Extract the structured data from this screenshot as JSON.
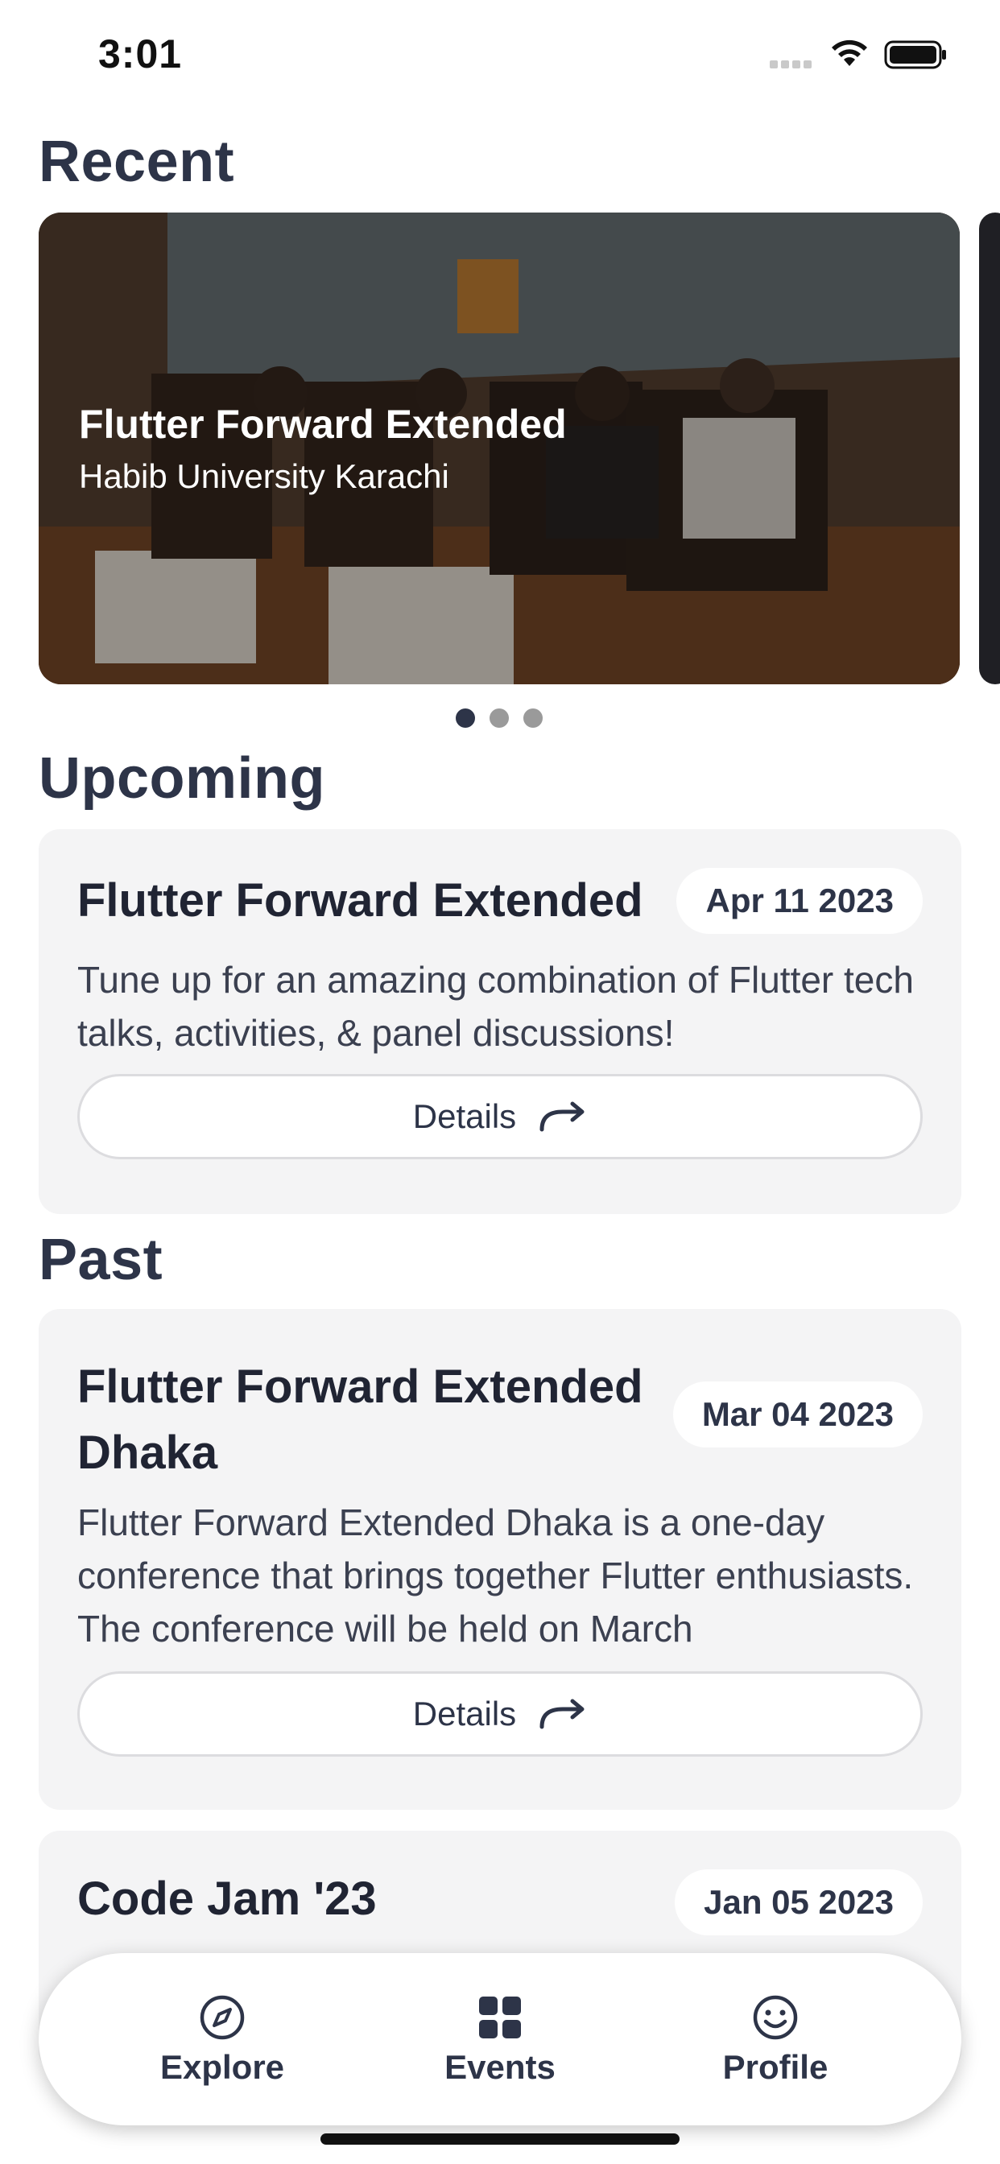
{
  "status_bar": {
    "time": "3:01"
  },
  "sections": {
    "recent": "Recent",
    "upcoming": "Upcoming",
    "past": "Past"
  },
  "recent": {
    "title": "Flutter Forward Extended",
    "subtitle": "Habib University Karachi",
    "page_count": 3,
    "active_page": 1
  },
  "upcoming": [
    {
      "title": "Flutter Forward Extended",
      "date": "Apr 11 2023",
      "description": "Tune up for an amazing combination of Flutter tech talks, activities, & panel discussions!",
      "details_label": "Details"
    }
  ],
  "past": [
    {
      "title": "Flutter Forward Extended Dhaka",
      "date": "Mar 04 2023",
      "description": "Flutter Forward Extended Dhaka is a one-day conference that brings together Flutter enthusiasts. The conference will be held on March",
      "details_label": "Details"
    },
    {
      "title": "Code Jam '23",
      "date": "Jan 05 2023"
    }
  ],
  "nav": [
    {
      "label": "Explore",
      "icon": "compass-icon"
    },
    {
      "label": "Events",
      "icon": "grid-icon"
    },
    {
      "label": "Profile",
      "icon": "smiley-icon"
    }
  ],
  "colors": {
    "primary": "#2d3448",
    "card_bg": "#f4f4f5",
    "dot_inactive": "#9a9a9a"
  }
}
